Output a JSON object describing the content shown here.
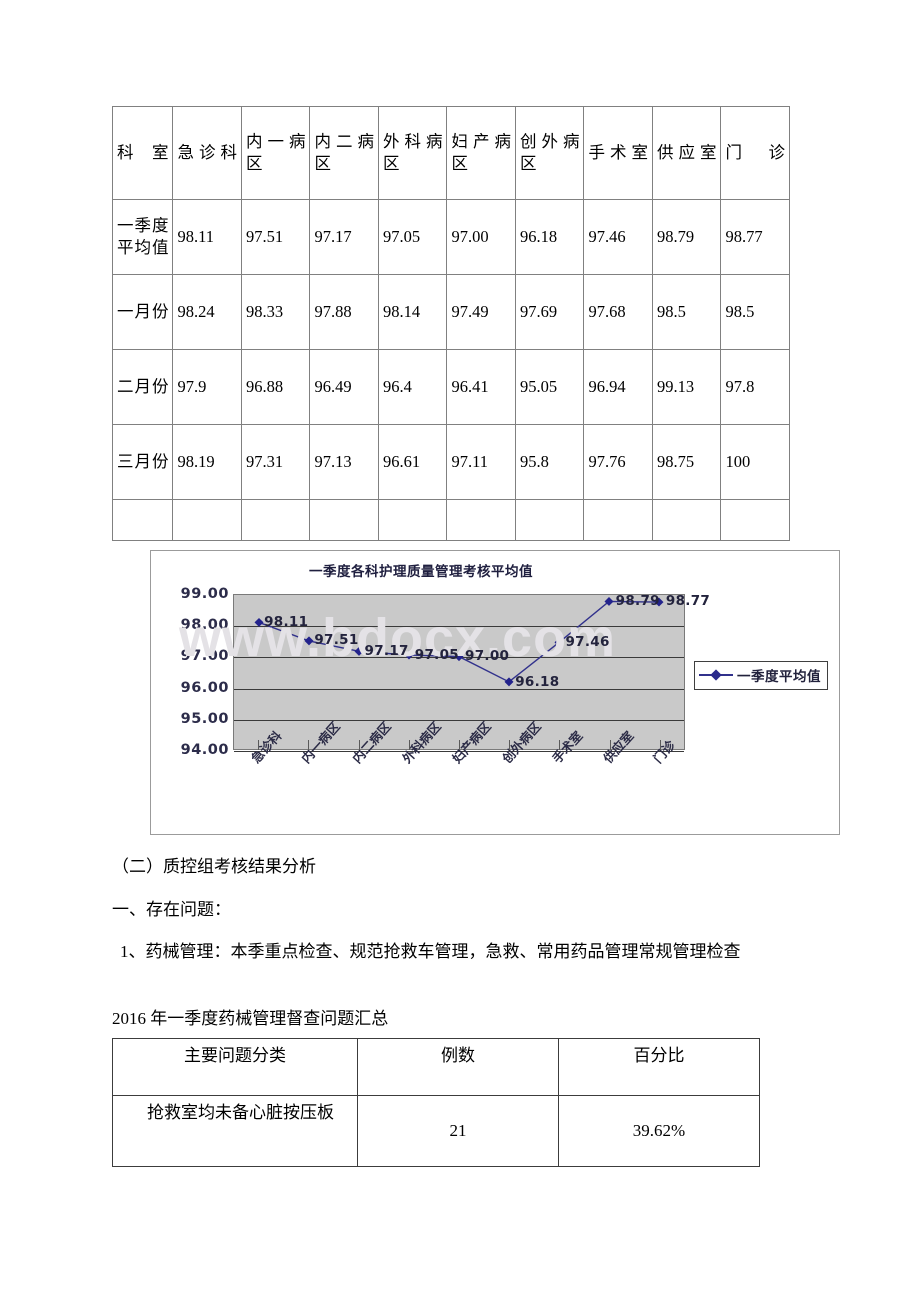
{
  "top_table": {
    "headers": [
      "科室",
      "急诊科",
      "内一病区",
      "内二病区",
      "外科病区",
      "妇产病区",
      "创外病区",
      "手术室",
      "供应室",
      "门诊"
    ],
    "rows": [
      {
        "label": "一季度平均值",
        "values": [
          "98.11",
          "97.51",
          "97.17",
          "97.05",
          "97.00",
          "96.18",
          "97.46",
          "98.79",
          "98.77"
        ]
      },
      {
        "label": "一月份",
        "values": [
          "98.24",
          "98.33",
          "97.88",
          "98.14",
          "97.49",
          "97.69",
          "97.68",
          "98.5",
          "98.5"
        ]
      },
      {
        "label": "二月份",
        "values": [
          "97.9",
          "96.88",
          "96.49",
          "96.4",
          "96.41",
          "95.05",
          "96.94",
          "99.13",
          "97.8"
        ]
      },
      {
        "label": "三月份",
        "values": [
          "98.19",
          "97.31",
          "97.13",
          "96.61",
          "97.11",
          "95.8",
          "97.76",
          "98.75",
          "100"
        ]
      },
      {
        "label": "",
        "values": [
          "",
          "",
          "",
          "",
          "",
          "",
          "",
          "",
          ""
        ]
      }
    ]
  },
  "chart_data": {
    "type": "line",
    "title": "一季度各科护理质量管理考核平均值",
    "categories": [
      "急诊科",
      "内一病区",
      "内二病区",
      "外科病区",
      "妇产病区",
      "创外病区",
      "手术室",
      "供应室",
      "门诊"
    ],
    "series": [
      {
        "name": "一季度平均值",
        "values": [
          98.11,
          97.51,
          97.17,
          97.05,
          97.0,
          96.18,
          97.46,
          98.79,
          98.77
        ],
        "color": "#31318c"
      }
    ],
    "data_labels": [
      "98.11",
      "97.51",
      "97.17",
      "97.05",
      "97.00",
      "96.18",
      "97.46",
      "98.79",
      "98.77"
    ],
    "yticks": [
      "99.00",
      "98.00",
      "97.00",
      "96.00",
      "95.00",
      "94.00"
    ],
    "ylim": [
      94.0,
      99.0
    ],
    "xlabel": "",
    "ylabel": "",
    "grid": true,
    "legend_position": "right",
    "plot_background": "#c9c9c9",
    "watermark": "www.bdocx.com"
  },
  "body": {
    "para_1": "（二）质控组考核结果分析",
    "para_2": "一、存在问题：",
    "para_3": "1、药械管理：本季重点检查、规范抢救车管理，急救、常用药品管理常规管理检查",
    "para_4": "2016 年一季度药械管理督查问题汇总"
  },
  "bottom_table": {
    "headers": [
      "主要问题分类",
      "例数",
      "百分比"
    ],
    "rows": [
      {
        "issue": "抢救室均未备心脏按压板",
        "count": "21",
        "percent": "39.62%"
      }
    ]
  }
}
